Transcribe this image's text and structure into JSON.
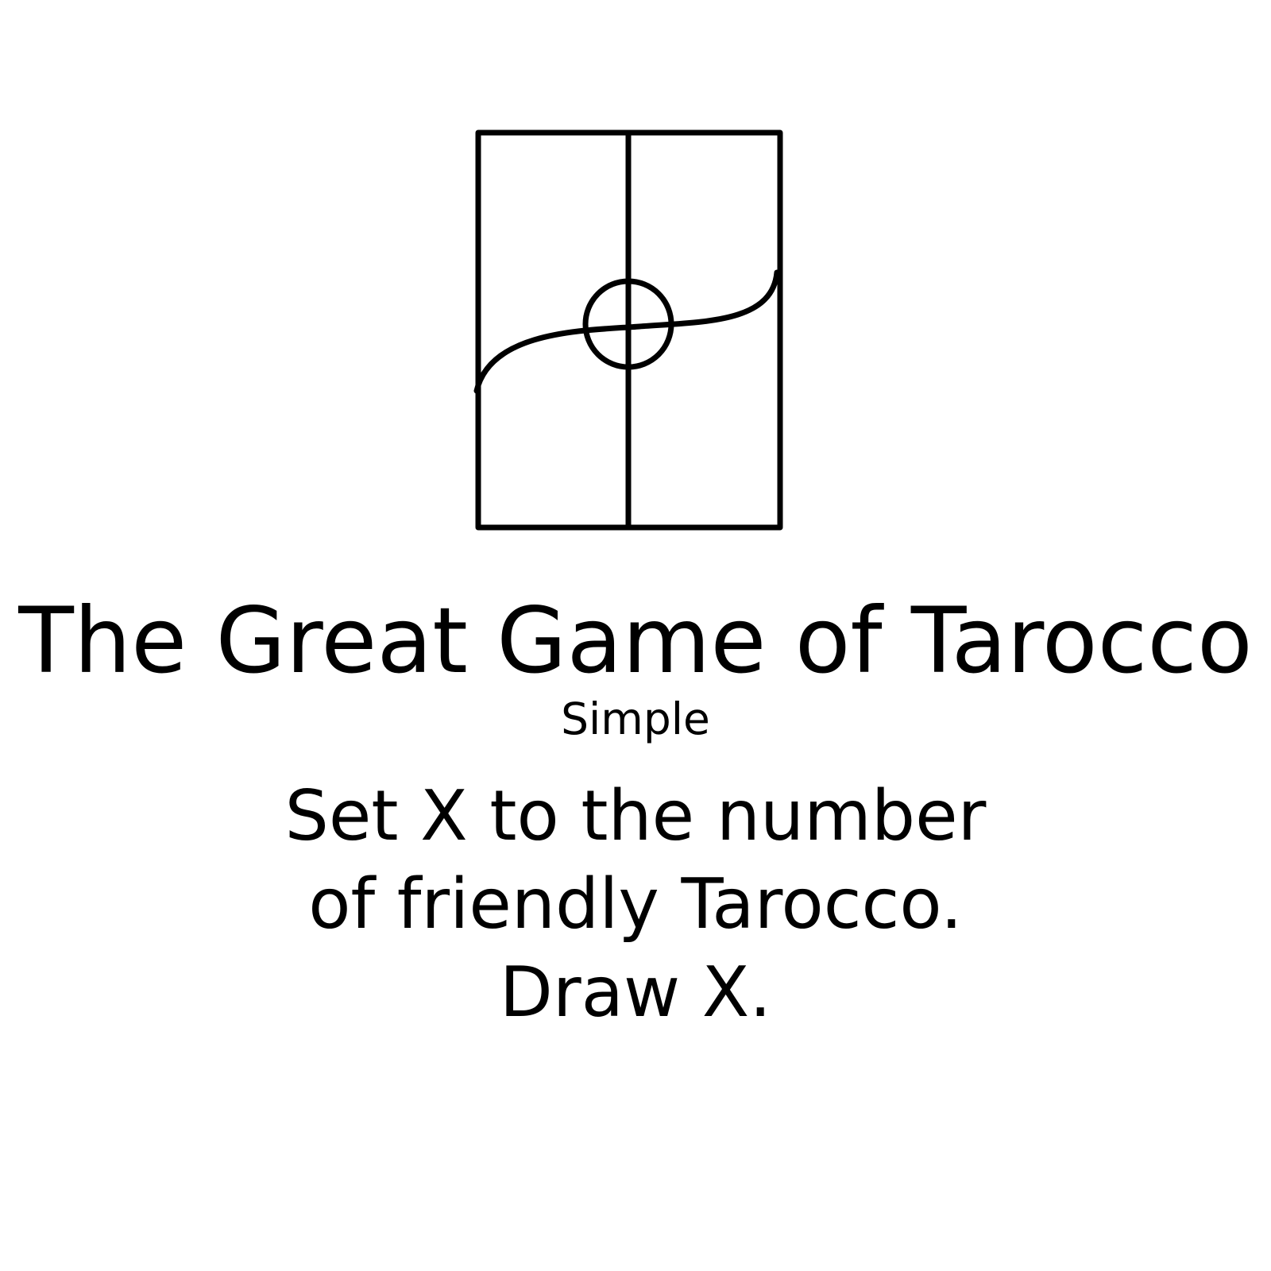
{
  "card": {
    "title": "The Great Game of Tarocco",
    "subtitle": "Simple",
    "rules": [
      "Set X to the number",
      "of friendly Tarocco.",
      "Draw X."
    ],
    "art_icon": "tarocco-emblem-icon",
    "ink_color": "#000000",
    "background_color": "#ffffff"
  }
}
